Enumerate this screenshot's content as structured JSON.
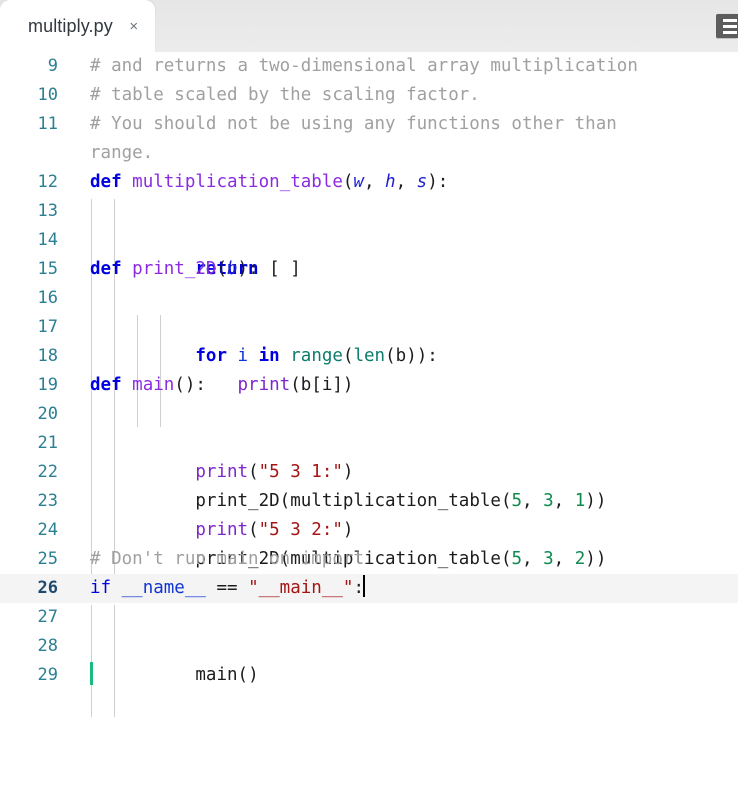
{
  "window": {
    "background": "#ffffff"
  },
  "tabbar": {
    "background": "#e9e9e9",
    "tabs": [
      {
        "label": "multiply.py",
        "close_label": "×",
        "active": true
      }
    ],
    "menu_icon": "list-menu-icon"
  },
  "editor": {
    "language": "python",
    "first_visible_line": 9,
    "last_visible_line": 29,
    "active_line": 26,
    "cursor_line": 26,
    "colors": {
      "comment": "#a0a0a0",
      "keyword": "#0000e0",
      "function": "#8a2be2",
      "builtin": "#0e7c6b",
      "number": "#0e8a4f",
      "string": "#a41515",
      "parameter": "#2020d0",
      "linenumber": "#2a7f93",
      "active_line_bg": "#f4f4f4",
      "indent_guide": "#cfcfcf",
      "caret": "#000000",
      "marker": "#18bd7d"
    },
    "lines": [
      {
        "n": "9",
        "text": "# and returns a two-dimensional array multiplication"
      },
      {
        "n": "10",
        "text": "# table scaled by the scaling factor."
      },
      {
        "n": "11",
        "text": "# You should not be using any functions other than range."
      },
      {
        "n": "12",
        "text": "def multiplication_table(w, h, s):"
      },
      {
        "n": "13",
        "text": "        return [ ]"
      },
      {
        "n": "14",
        "text": ""
      },
      {
        "n": "15",
        "text": "def print_2D(b):"
      },
      {
        "n": "16",
        "text": "        for i in range(len(b)):"
      },
      {
        "n": "17",
        "text": "                print(b[i])"
      },
      {
        "n": "18",
        "text": ""
      },
      {
        "n": "19",
        "text": "def main():"
      },
      {
        "n": "20",
        "text": "        print(\"5 3 1:\")"
      },
      {
        "n": "21",
        "text": "        print_2D(multiplication_table(5, 3, 1))"
      },
      {
        "n": "22",
        "text": "        print(\"5 3 2:\")"
      },
      {
        "n": "23",
        "text": "        print_2D(multiplication_table(5, 3, 2))"
      },
      {
        "n": "24",
        "text": ""
      },
      {
        "n": "25",
        "text": "# Don't run main on import"
      },
      {
        "n": "26",
        "text": "if __name__ == \"__main__\":"
      },
      {
        "n": "27",
        "text": "        main()"
      },
      {
        "n": "28",
        "text": ""
      },
      {
        "n": "29",
        "text": ""
      }
    ],
    "tokens": {
      "l9": {
        "comment": "# and returns a two-dimensional array multiplication"
      },
      "l10": {
        "comment": "# table scaled by the scaling factor."
      },
      "l11": {
        "comment": "# You should not be using any functions other than",
        "comment_wrap": "range."
      },
      "l12": {
        "kw": "def",
        "fn": "multiplication_table",
        "p1": "w",
        "p2": "h",
        "p3": "s"
      },
      "l13": {
        "kw": "return",
        "rest": "[ ]"
      },
      "l15": {
        "kw": "def",
        "fn": "print_2D",
        "p1": "b"
      },
      "l16": {
        "kw": "for",
        "var": "i",
        "kw2": "in",
        "bi1": "range",
        "bi2": "len",
        "arg": "b"
      },
      "l17": {
        "fn": "print",
        "arg": "b[i]"
      },
      "l19": {
        "kw": "def",
        "fn": "main"
      },
      "l20": {
        "fn": "print",
        "str": "\"5 3 1:\""
      },
      "l21": {
        "fn": "print_2D",
        "fn2": "multiplication_table",
        "n1": "5",
        "n2": "3",
        "n3": "1"
      },
      "l22": {
        "fn": "print",
        "str": "\"5 3 2:\""
      },
      "l23": {
        "fn": "print_2D",
        "fn2": "multiplication_table",
        "n1": "5",
        "n2": "3",
        "n3": "2"
      },
      "l25": {
        "comment": "# Don't run main on import"
      },
      "l26": {
        "kw": "if",
        "var": "__name__",
        "op": " == ",
        "str": "\"__main__\"",
        "colon": ":"
      },
      "l27": {
        "fn": "main",
        "parens": "()"
      }
    }
  }
}
